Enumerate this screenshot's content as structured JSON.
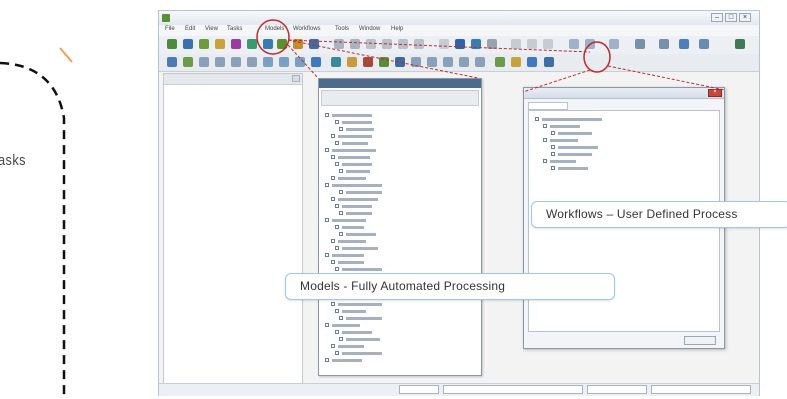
{
  "left_label": "asks",
  "app": {
    "title": "",
    "window_controls": [
      "–",
      "□",
      "×"
    ],
    "menu": [
      "File",
      "Edit",
      "View",
      "Tasks",
      "Models",
      "Workflows",
      "Tools",
      "Window",
      "Help"
    ]
  },
  "models_window": {
    "title": "",
    "header": ""
  },
  "workflows_window": {
    "title": "",
    "tab": "",
    "ok_label": ""
  },
  "statusbar": {
    "text": "",
    "cells": [
      "",
      "",
      "",
      ""
    ]
  },
  "callouts": {
    "models": "Models - Fully Automated Processing",
    "workflows": "Workflows – User Defined Process"
  },
  "colors": {
    "callout_border": "#9ec7ea",
    "highlight_circle": "#c0282e",
    "accent_orange": "#f0a05a"
  }
}
